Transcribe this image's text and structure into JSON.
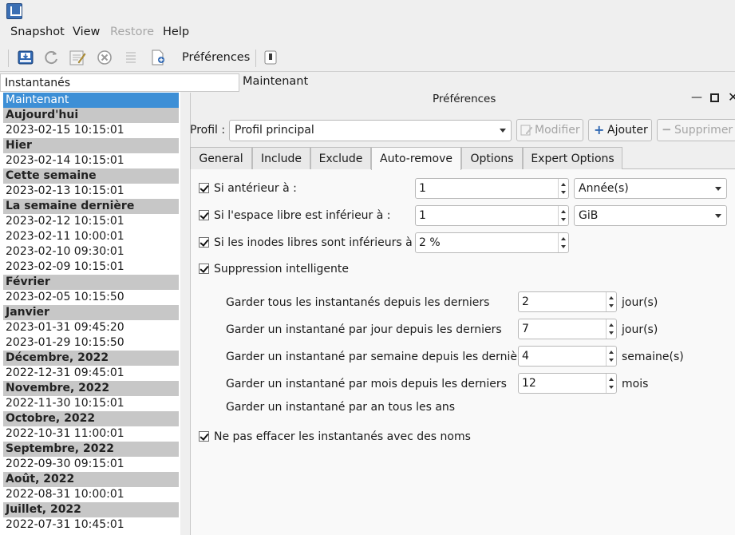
{
  "menu": {
    "snapshot": "Snapshot",
    "view": "View",
    "restore": "Restore",
    "help": "Help"
  },
  "toolbar": {
    "preferences_label": "Préférences",
    "icons": [
      "take-snapshot-icon",
      "refresh-icon",
      "edit-name-icon",
      "remove-icon",
      "log-icon",
      "new-document-icon",
      "shutdown-icon"
    ]
  },
  "left_panel": {
    "header": "Instantanés",
    "rows": [
      {
        "type": "selected",
        "text": "Maintenant"
      },
      {
        "type": "group",
        "text": "Aujourd'hui"
      },
      {
        "type": "item",
        "text": "2023-02-15 10:15:01"
      },
      {
        "type": "group",
        "text": "Hier"
      },
      {
        "type": "item",
        "text": "2023-02-14 10:15:01"
      },
      {
        "type": "group",
        "text": "Cette semaine"
      },
      {
        "type": "item",
        "text": "2023-02-13 10:15:01"
      },
      {
        "type": "group",
        "text": "La semaine dernière"
      },
      {
        "type": "item",
        "text": "2023-02-12 10:15:01"
      },
      {
        "type": "item",
        "text": "2023-02-11 10:00:01"
      },
      {
        "type": "item",
        "text": "2023-02-10 09:30:01"
      },
      {
        "type": "item",
        "text": "2023-02-09 10:15:01"
      },
      {
        "type": "group",
        "text": "Février"
      },
      {
        "type": "item",
        "text": "2023-02-05 10:15:50"
      },
      {
        "type": "group",
        "text": "Janvier"
      },
      {
        "type": "item",
        "text": "2023-01-31 09:45:20"
      },
      {
        "type": "item",
        "text": "2023-01-29 10:15:50"
      },
      {
        "type": "group",
        "text": "Décembre, 2022"
      },
      {
        "type": "item",
        "text": "2022-12-31 09:45:01"
      },
      {
        "type": "group",
        "text": "Novembre, 2022"
      },
      {
        "type": "item",
        "text": "2022-11-30 10:15:01"
      },
      {
        "type": "group",
        "text": "Octobre, 2022"
      },
      {
        "type": "item",
        "text": "2022-10-31 11:00:01"
      },
      {
        "type": "group",
        "text": "Septembre, 2022"
      },
      {
        "type": "item",
        "text": "2022-09-30 09:15:01"
      },
      {
        "type": "group",
        "text": "Août, 2022"
      },
      {
        "type": "item",
        "text": "2022-08-31 10:00:01"
      },
      {
        "type": "group",
        "text": "Juillet, 2022"
      },
      {
        "type": "item",
        "text": "2022-07-31 10:45:01"
      }
    ]
  },
  "main": {
    "title": "Maintenant"
  },
  "dialog": {
    "title": "Préférences",
    "profile_label": "Profil :",
    "profile_value": "Profil principal",
    "modify_label": "Modifier",
    "add_label": "Ajouter",
    "delete_label": "Supprimer",
    "tabs": [
      "General",
      "Include",
      "Exclude",
      "Auto-remove",
      "Options",
      "Expert Options"
    ],
    "active_tab": "Auto-remove",
    "auto_remove": {
      "older_than": {
        "label": "Si antérieur à :",
        "value": "1",
        "unit": "Année(s)"
      },
      "free_space": {
        "label": "Si l'espace libre est inférieur à :",
        "value": "1",
        "unit": "GiB"
      },
      "free_inodes": {
        "label": "Si les inodes libres sont inférieurs à :",
        "value": "2 %"
      },
      "smart_remove": {
        "label": "Suppression intelligente"
      },
      "keep_all": {
        "label": "Garder tous les instantanés depuis les derniers",
        "value": "2",
        "unit": "jour(s)"
      },
      "keep_daily": {
        "label": "Garder un instantané par jour depuis les derniers",
        "value": "7",
        "unit": "jour(s)"
      },
      "keep_weekly": {
        "label": "Garder un instantané par semaine depuis les dernières",
        "value": "4",
        "unit": "semaine(s)"
      },
      "keep_monthly": {
        "label": "Garder un instantané par mois depuis les derniers",
        "value": "12",
        "unit": "mois"
      },
      "keep_yearly": {
        "label": "Garder un instantané par an tous les ans"
      },
      "dont_remove_named": {
        "label": "Ne pas effacer les instantanés avec des noms"
      }
    }
  }
}
